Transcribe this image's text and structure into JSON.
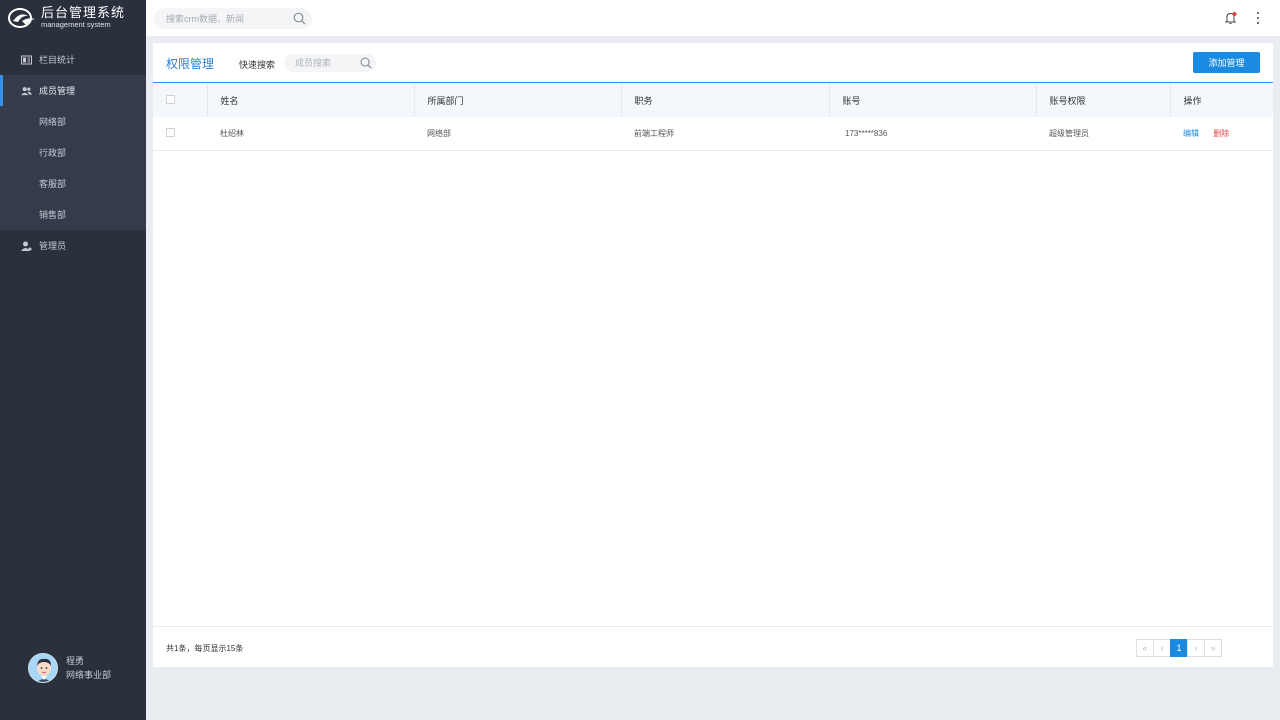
{
  "app": {
    "logo_title": "后台管理系统",
    "logo_sub": "management system"
  },
  "sidebar": {
    "items": [
      {
        "label": "栏目统计",
        "icon": "book-icon"
      },
      {
        "label": "成员管理",
        "icon": "users-icon",
        "active": true
      },
      {
        "label": "管理员",
        "icon": "user-icon"
      }
    ],
    "sub_items": [
      {
        "label": "网络部"
      },
      {
        "label": "行政部"
      },
      {
        "label": "客服部"
      },
      {
        "label": "销售部"
      }
    ]
  },
  "user": {
    "name": "程勇",
    "dept": "网络事业部"
  },
  "topbar": {
    "search_placeholder": "搜索crm数据、新闻"
  },
  "panel": {
    "title": "权限管理",
    "quick_search_label": "快速搜索",
    "quick_search_placeholder": "成员搜索",
    "add_button": "添加管理"
  },
  "table": {
    "headers": [
      "姓名",
      "所属部门",
      "职务",
      "账号",
      "账号权限",
      "操作"
    ],
    "rows": [
      {
        "name": "杜绍林",
        "dept": "网络部",
        "title": "前端工程师",
        "account": "173*****836",
        "permission": "超级管理员",
        "edit": "编辑",
        "delete": "删除"
      }
    ]
  },
  "pagination": {
    "summary": "共1条，每页显示15条",
    "current_page": "1",
    "first": "«",
    "prev": "‹",
    "next": "›",
    "last": "»"
  },
  "colors": {
    "accent": "#1a8be0",
    "sidebar_bg": "#2a303c",
    "danger": "#e64242"
  }
}
